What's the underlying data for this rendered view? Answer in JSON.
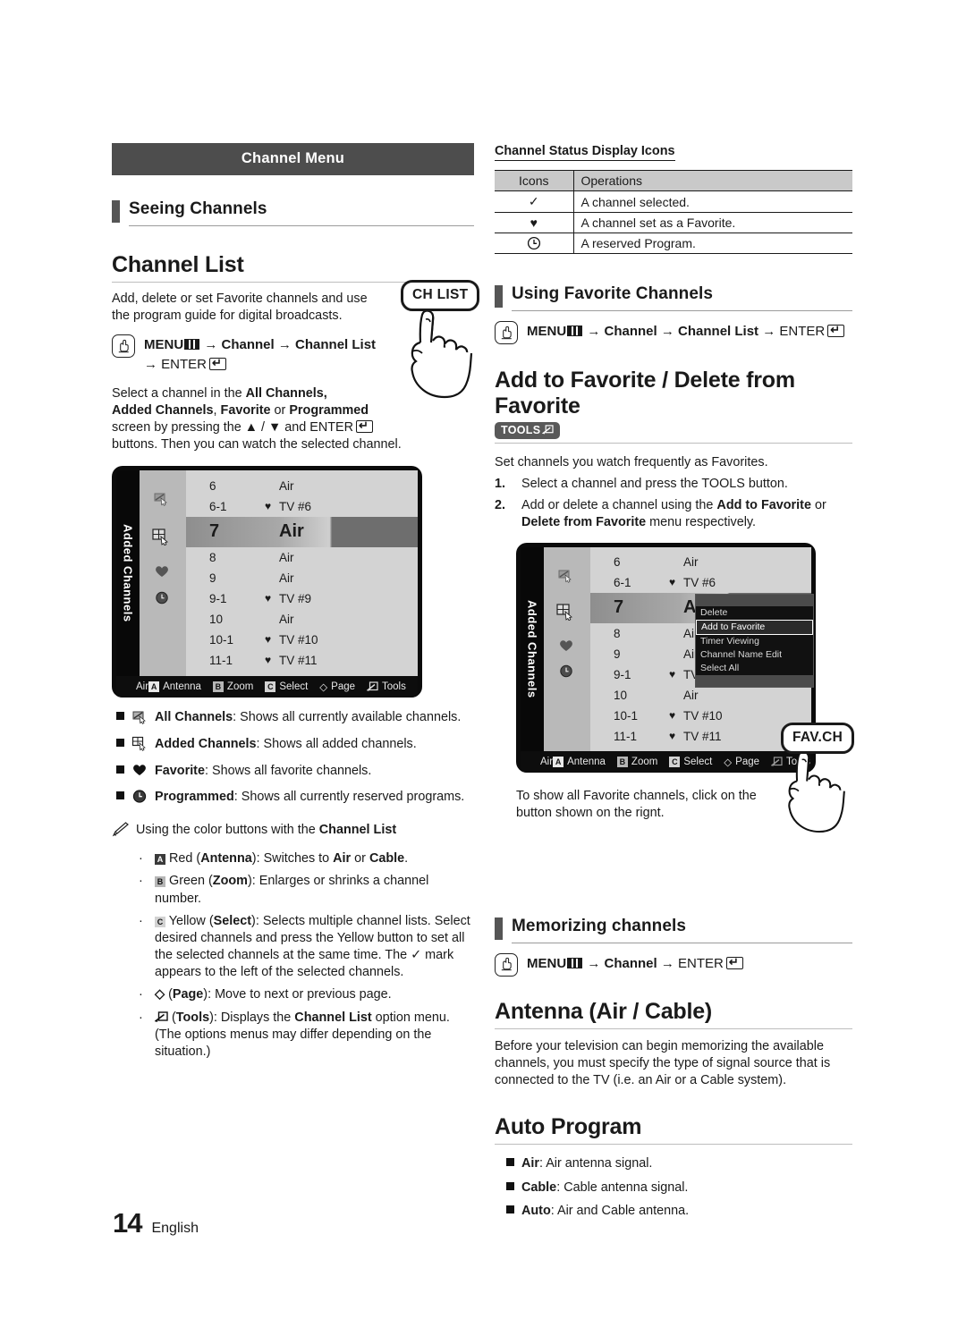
{
  "chapter_banner": "Channel Menu",
  "left": {
    "section_heading": "Seeing Channels",
    "topic_channel_list": "Channel List",
    "intro": "Add, delete or set Favorite channels and use the program guide for digital broadcasts.",
    "menu_path_1": {
      "menu": "MENU",
      "arrow1": "→",
      "channel": "Channel",
      "arrow2": "→",
      "channel_list": "Channel List",
      "arrow3": "→",
      "enter": "ENTER"
    },
    "select_para_line1_a": "Select a channel in the ",
    "select_para_b1": "All Channels,",
    "select_para_b2": "Added Channels",
    "select_para_mid1": ", ",
    "select_para_b3": "Favorite",
    "select_para_mid2": " or ",
    "select_para_b4": "Programmed",
    "select_para_line3": "screen by pressing the ▲ / ▼ and ENTER",
    "select_para_line4": "buttons. Then you can watch the selected channel.",
    "remote_button": "CH LIST",
    "tv_screen": {
      "tab_label": "Added Channels",
      "source": "Air",
      "rows": [
        {
          "num": "6",
          "fav": "",
          "name": "Air"
        },
        {
          "num": "6-1",
          "fav": "♥",
          "name": "TV #6"
        },
        {
          "num": "7",
          "fav": "",
          "name": "Air",
          "selected": true
        },
        {
          "num": "8",
          "fav": "",
          "name": "Air"
        },
        {
          "num": "9",
          "fav": "",
          "name": "Air"
        },
        {
          "num": "9-1",
          "fav": "♥",
          "name": "TV #9"
        },
        {
          "num": "10",
          "fav": "",
          "name": "Air"
        },
        {
          "num": "10-1",
          "fav": "♥",
          "name": "TV #10"
        },
        {
          "num": "11-1",
          "fav": "♥",
          "name": "TV #11"
        }
      ],
      "keys": [
        {
          "cap": "A",
          "label": "Antenna"
        },
        {
          "cap": "B",
          "label": "Zoom"
        },
        {
          "cap": "C",
          "label": "Select"
        },
        {
          "cap": "◇",
          "label": "Page"
        },
        {
          "cap": "T",
          "label": "Tools"
        }
      ]
    },
    "bullets": [
      {
        "icon": "all-channels-icon",
        "bold": "All Channels",
        "text": ": Shows all currently available channels."
      },
      {
        "icon": "added-channels-icon",
        "bold": "Added Channels",
        "text": ": Shows all added channels."
      },
      {
        "icon": "heart-icon",
        "bold": "Favorite",
        "text": ": Shows all favorite channels."
      },
      {
        "icon": "clock-icon",
        "bold": "Programmed",
        "text": ": Shows all currently reserved programs."
      }
    ],
    "note_lead": "Using the color buttons with the ",
    "note_bold": "Channel List",
    "color_buttons": [
      {
        "cap": "A",
        "color": "Red",
        "name": "Antenna",
        "desc": ": Switches to ",
        "b1": "Air",
        "mid": " or ",
        "b2": "Cable",
        "tail": "."
      },
      {
        "cap": "B",
        "color": "Green",
        "name": "Zoom",
        "desc": ": Enlarges or shrinks a channel number."
      },
      {
        "cap": "C",
        "color": "Yellow",
        "name": "Select",
        "desc": ": Selects multiple channel lists. Select desired channels and press the Yellow button to set all the selected channels at the same time. The ✓ mark appears to the left of the selected channels."
      },
      {
        "cap": "◇",
        "color": "",
        "name": "Page",
        "desc": ": Move to next or previous page."
      },
      {
        "cap": "T",
        "color": "",
        "name": "Tools",
        "desc": ": Displays the ",
        "b1": "Channel List",
        "tail": " option menu. (The options menus may differ depending on the situation.)"
      }
    ]
  },
  "right": {
    "table_title": "Channel Status Display Icons",
    "table_headers": [
      "Icons",
      "Operations"
    ],
    "table_rows": [
      {
        "icon": "✓",
        "icon_name": "check-icon",
        "op": "A channel selected."
      },
      {
        "icon": "♥",
        "icon_name": "heart-icon",
        "op": "A channel set as a Favorite."
      },
      {
        "icon": "◴",
        "icon_name": "clock-icon",
        "op": "A reserved Program."
      }
    ],
    "section_heading_fav": "Using Favorite Channels",
    "menu_path_2": {
      "menu": "MENU",
      "channel": "Channel",
      "channel_list": "Channel List",
      "enter": "ENTER"
    },
    "topic_add_fav": "Add to Favorite / Delete from Favorite",
    "tools_pill": "TOOLS",
    "add_fav_intro": "Set channels you watch frequently as Favorites.",
    "steps": [
      {
        "n": "1.",
        "text": "Select a channel and press the TOOLS button."
      },
      {
        "n": "2.",
        "text_a": "Add or delete a channel using the ",
        "b1": "Add to Favorite",
        "mid": " or ",
        "b2": "Delete from Favorite",
        "tail": " menu respectively."
      }
    ],
    "tv_screen2": {
      "tab_label": "Added Channels",
      "source": "Air",
      "rows": [
        {
          "num": "6",
          "fav": "",
          "name": "Air"
        },
        {
          "num": "6-1",
          "fav": "♥",
          "name": "TV #6"
        },
        {
          "num": "7",
          "fav": "",
          "name": "Air",
          "selected": true
        },
        {
          "num": "8",
          "fav": "",
          "name": "Air"
        },
        {
          "num": "9",
          "fav": "",
          "name": "Air"
        },
        {
          "num": "9-1",
          "fav": "♥",
          "name": "TV #9"
        },
        {
          "num": "10",
          "fav": "",
          "name": "Air"
        },
        {
          "num": "10-1",
          "fav": "♥",
          "name": "TV #10"
        },
        {
          "num": "11-1",
          "fav": "♥",
          "name": "TV #11"
        }
      ],
      "popup_items": [
        "Delete",
        "Add to Favorite",
        "Timer Viewing",
        "Channel Name Edit",
        "Select All"
      ],
      "popup_highlighted": "Add to Favorite",
      "keys": [
        {
          "cap": "A",
          "label": "Antenna"
        },
        {
          "cap": "B",
          "label": "Zoom"
        },
        {
          "cap": "C",
          "label": "Select"
        },
        {
          "cap": "◇",
          "label": "Page"
        },
        {
          "cap": "T",
          "label": "Tools"
        }
      ]
    },
    "fav_note": "To show all Favorite channels, click on the button shown on the rignt.",
    "fav_button": "FAV.CH",
    "section_heading_mem": "Memorizing channels",
    "menu_path_3": {
      "menu": "MENU",
      "channel": "Channel",
      "enter": "ENTER"
    },
    "topic_antenna": "Antenna (Air / Cable)",
    "antenna_text": "Before your television can begin memorizing the available channels, you must specify the type of signal source that is connected to the TV (i.e. an Air or a Cable system).",
    "topic_auto": "Auto Program",
    "auto_items": [
      {
        "bold": "Air",
        "text": ": Air antenna signal."
      },
      {
        "bold": "Cable",
        "text": ": Cable antenna signal."
      },
      {
        "bold": "Auto",
        "text": ": Air and Cable antenna."
      }
    ]
  },
  "footer": {
    "page_number": "14",
    "language": "English"
  },
  "colors": {
    "banner_bg": "#4d4d4d",
    "tick": "#555555",
    "table_header_bg": "#c9c9c9",
    "tv_bg": "#0b0b0b"
  }
}
